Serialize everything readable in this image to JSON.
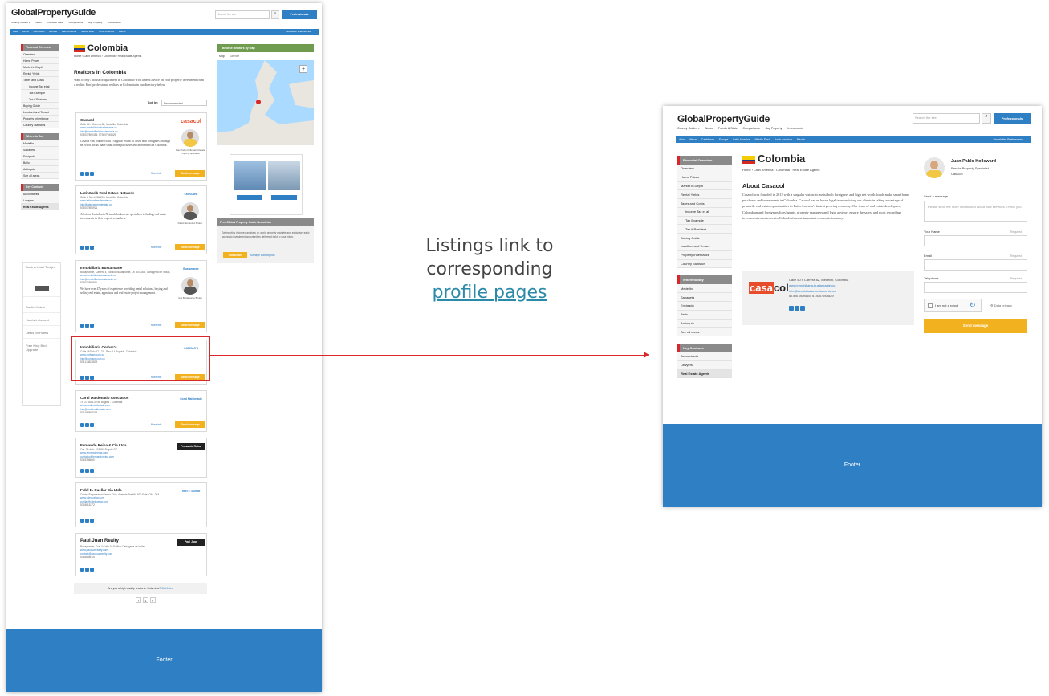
{
  "caption": {
    "line1": "Listings link to",
    "line2": "corresponding",
    "link": "profile pages"
  },
  "colors": {
    "brand_blue": "#2f7fc4",
    "accent_red": "#d9262a",
    "button_yellow": "#f2b11f",
    "sidebar_grey": "#8a8a8a"
  },
  "site": {
    "logo": "GlobalPropertyGuide",
    "nav": [
      "Country Guides ▾",
      "News",
      "Trends & Stats",
      "Comparisons",
      "Buy Property",
      "Investments"
    ],
    "search_placeholder": "Search the site",
    "professionals_label": "Professionals",
    "regions": [
      "Asia",
      "Africa",
      "Caribbean",
      "Europe",
      "Latin America",
      "Middle East",
      "North America",
      "Pacific"
    ],
    "newsletter_prefs": "Newsletter Preferences",
    "footer": "Footer"
  },
  "sidebar": {
    "financial_overview": {
      "title": "Financial Overview",
      "items": [
        "Overview",
        "Home Prices",
        "Market in Depth",
        "Rental Yields",
        "Taxes and Costs",
        "Income Tax et al",
        "Tax Example",
        "Tax if Resident",
        "Buying Guide",
        "Landlord and Tenant",
        "Property Inheritance",
        "Country Statistics"
      ]
    },
    "where_to_buy": {
      "title": "Where to Buy",
      "items": [
        "Medellin",
        "Sabaneta",
        "Envigado",
        "Bello",
        "Antioquia",
        "See all areas"
      ]
    },
    "key_contacts": {
      "title": "Key Contacts",
      "items": [
        "Accountants",
        "Lawyers",
        "Real Estate Agents"
      ]
    }
  },
  "left": {
    "country": "Colombia",
    "breadcrumb": "Home › Latin America › Colombia › Real Estate Agents",
    "heading": "Realtors in Colombia",
    "intro": "Want to buy a house or apartment in Colombia? You'll need advice on your property investment from a realtor. Find professional realtors in Colombia in our directory below.",
    "sort_label": "Sort by:",
    "sort_value": "Recommended",
    "map_title": "Browse Realtors by Map",
    "map_tabs": [
      "Map",
      "Satellite"
    ],
    "newsletter_title": "Free Global Property Guide Newsletter",
    "newsletter_text": "Get monthly informed analysis on world property markets and exclusive, early access to investment opportunities delivered right to your inbox.",
    "subscribe": "Subscribe",
    "manage_subs": "Manage subscription",
    "bottom_question": "Are you a high quality realtor in Colombia?",
    "bottom_link": "Get listed",
    "ad_side": [
      "Book A Hotel Tonight",
      "Dublin Hotels",
      "Hotels in Ireland",
      "Deals on Hotels",
      "Free King Bed Upgrade"
    ],
    "send_message": "Send message",
    "more_info": "More info",
    "listings": [
      {
        "name": "Casacol",
        "address": "Calle 50 x Carrera 82, Medellin, Colombia",
        "website": "www.inmobiliaria-bustamante.co",
        "email": "info@inmobiliaria-bustamante.co",
        "phone": "573007809455, 573007945529",
        "desc": "Casacol was founded with a singular vision: to assist both foreigners and high net worth locals make smart home purchases and investments in Colombia.",
        "agent": "Juan Pablo Kolleward Resale Property Specialist",
        "logo": "casacol"
      },
      {
        "name": "LatinCarib Real Estate Network",
        "address": "Calle 6 Sur #43A-200, Medellin, Colombia",
        "website": "www.latincaribrealestate.co",
        "email": "info@latincaribrealestate.co",
        "phone": "573007805921",
        "desc": "All of our LatinCarib Network brokers are specialists in finding real estate investments in their respective markets.",
        "agent": "David Hernandez Broker",
        "logo": "LatinCarib"
      },
      {
        "name": "Inmobiliaria Bustamante",
        "address": "Bocagrande, Carrera 4, Edificio Bustamante, Of. 300-308, Cartagena de Indias, Colombia",
        "website": "www.inmobiliariabustamante.co",
        "email": "info@inmobiliariabustamante.co",
        "phone": "573007809911",
        "desc": "We have over 47 years of experience providing rental solutions, buying and selling real estate, appraisals and real estate project management.",
        "agent": "Ana Bustamante Broker",
        "logo": "Bustamante"
      },
      {
        "name": "Inmobiliaria Corbac's",
        "address": "Calle 163 No 27 - 21 - Piso 2 * Bogotá - Colombia",
        "website": "www.corbacs.com.co",
        "email": "info@corbacs.com.co",
        "phone": "573174823839",
        "desc": "",
        "agent": "",
        "logo": "COBRAC'S"
      },
      {
        "name": "Coral Maldonado Asociados",
        "address": "TR 27 30 A-09 de Bogotá - Colombia",
        "website": "www.coralmaldonado.com",
        "email": "info@coralmaldonado.com",
        "phone": "573168888315",
        "desc": "",
        "agent": "",
        "logo": "Coral Maldonado"
      },
      {
        "name": "Fernando Reina & Cia Ltda",
        "address": "Cra. 7A #No. 118-96, Bogotá DC",
        "website": "www.fernandoreina.com",
        "email": "contacto@fernandoreina.com",
        "phone": "5716196860",
        "desc": "",
        "agent": "",
        "logo": "Fernando Reina"
      },
      {
        "name": "Fidel E. Cuellar Cia Ltda",
        "address": "Centro Empresarial Centro Chía, Avenida Pradilla 900 Este, Ofic. 203",
        "website": "www.fidelcuellar.com",
        "email": "cuellar@fidelcuellar.com",
        "phone": "5718615272",
        "desc": "",
        "agent": "",
        "logo": "fidel e. cuellar"
      },
      {
        "name": "Paul Juan Realty",
        "address": "Bocagrande, Cra. 4 Calle 10 Edificio Cartagena de Indias",
        "website": "www.pauljuanrealty.com",
        "email": "contact@pauljuanrealty.com",
        "phone": "5756655815",
        "desc": "",
        "agent": "",
        "logo": "Paul Juan"
      }
    ],
    "pagination": [
      "‹",
      "1",
      "›"
    ]
  },
  "right": {
    "country": "Colombia",
    "breadcrumb": "Home › Latin America › Colombia › Real Estate Agents",
    "about_title": "About Casacol",
    "about_text": "Casacol was founded in 2013 with a singular vision: to assist both foreigners and high net worth locals make smart home purchases and investments in Colombia. Casacol has an house legal team assisting our clients in taking advantage of primarily real estate opportunities in Latin America's fastest growing economy. Our team of real estate developers, Colombian and foreign realtors/agents, property managers and legal advisors ensure the safest and most rewarding investment experiences in Colombia's most important economic industry.",
    "contact": {
      "logo_left": "casa",
      "logo_right": "col",
      "address": "Calle 50 x Carrera 82, Medellin, Colombia",
      "website": "www.inmobiliaria-bustamante.co",
      "email": "info@inmobiliaria-bustamante.co",
      "phone": "573007809455, 573007945529"
    },
    "agent": {
      "name": "Juan Pablo Kolleward",
      "role": "Resale Property Specialist",
      "company": "Casacol"
    },
    "form": {
      "send_label": "Send a message",
      "message_placeholder": "Please send me more information about your services. Thank you.",
      "your_name": "Your Name",
      "email": "Email",
      "telephone": "Telephone",
      "required": "Required",
      "robot": "I am not a robot",
      "privacy": "Data privacy",
      "submit": "Send message"
    }
  }
}
